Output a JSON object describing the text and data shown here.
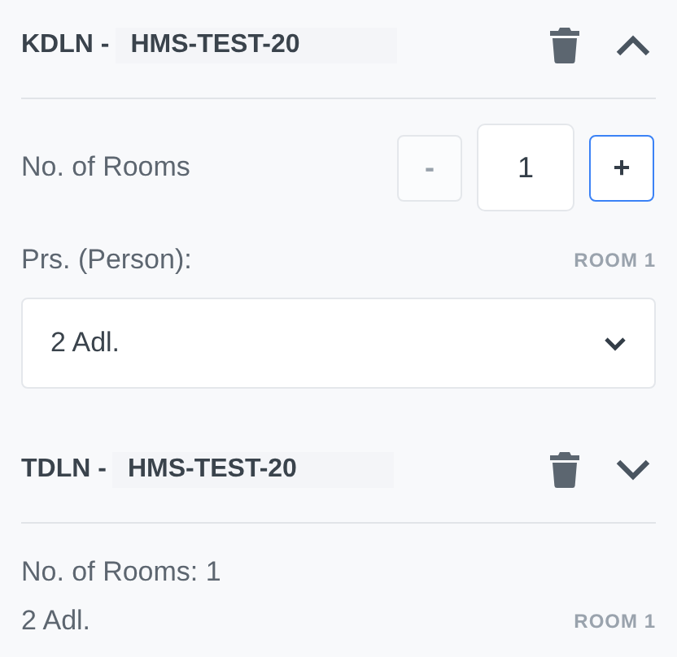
{
  "sections": [
    {
      "code": "KDLN -",
      "name": "HMS-TEST-20",
      "expanded": true,
      "rooms_label": "No. of Rooms",
      "decrement": "-",
      "decrement_disabled": true,
      "count": "1",
      "increment": "+",
      "persons_label": "Prs. (Person):",
      "room_tag": "ROOM 1",
      "persons_value": "2 Adl."
    },
    {
      "code": "TDLN -",
      "name": "HMS-TEST-20",
      "expanded": false,
      "rooms_summary": "No. of Rooms: 1",
      "persons_summary": "2 Adl.",
      "room_tag": "ROOM 1"
    }
  ]
}
